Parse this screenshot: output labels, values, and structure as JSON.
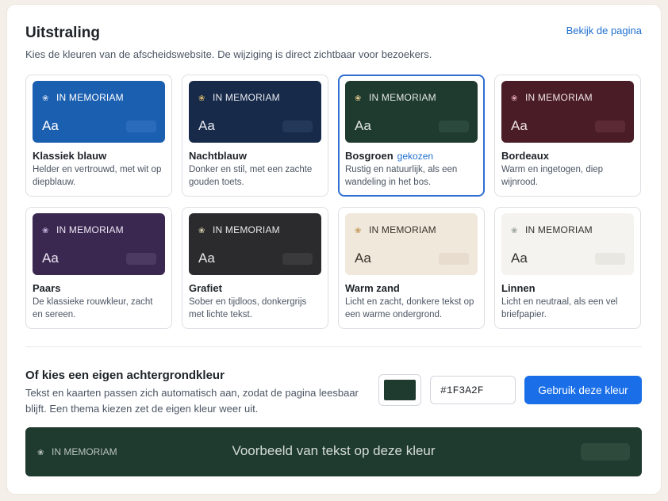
{
  "header": {
    "title": "Uitstraling",
    "view_link": "Bekijk de pagina",
    "subtitle": "Kies de kleuren van de afscheidswebsite. De wijziging is direct zichtbaar voor bezoekers."
  },
  "themes": [
    {
      "name": "Klassiek blauw",
      "desc": "Helder en vertrouwd, met wit op diepblauw.",
      "memo": "IN MEMORIAM",
      "aa": "Aa",
      "bg": "#1b5fb0",
      "text": "#ffffff",
      "pill": "#2a6cbb",
      "flower": "#c7d6ee",
      "selected": false
    },
    {
      "name": "Nachtblauw",
      "desc": "Donker en stil, met een zachte gouden toets.",
      "memo": "IN MEMORIAM",
      "aa": "Aa",
      "bg": "#172a4a",
      "text": "#e8eaef",
      "pill": "#24395a",
      "flower": "#d4b56a",
      "selected": false
    },
    {
      "name": "Bosgroen",
      "chosen": "gekozen",
      "desc": "Rustig en natuurlijk, als een wandeling in het bos.",
      "memo": "IN MEMORIAM",
      "aa": "Aa",
      "bg": "#1f3a2f",
      "text": "#e3e9e5",
      "pill": "#2b4a3d",
      "flower": "#d8c58a",
      "selected": true
    },
    {
      "name": "Bordeaux",
      "desc": "Warm en ingetogen, diep wijnrood.",
      "memo": "IN MEMORIAM",
      "aa": "Aa",
      "bg": "#4a1c26",
      "text": "#efe3e5",
      "pill": "#5c2a34",
      "flower": "#e0a4b4",
      "selected": false
    },
    {
      "name": "Paars",
      "desc": "De klassieke rouwkleur, zacht en sereen.",
      "memo": "IN MEMORIAM",
      "aa": "Aa",
      "bg": "#3b2850",
      "text": "#ece6f3",
      "pill": "#4c3a62",
      "flower": "#c6b2e0",
      "selected": false
    },
    {
      "name": "Grafiet",
      "desc": "Sober en tijdloos, donkergrijs met lichte tekst.",
      "memo": "IN MEMORIAM",
      "aa": "Aa",
      "bg": "#2b2b2d",
      "text": "#e8e8ea",
      "pill": "#3a3a3d",
      "flower": "#d0c7a8",
      "selected": false
    },
    {
      "name": "Warm zand",
      "desc": "Licht en zacht, donkere tekst op een warme ondergrond.",
      "memo": "IN MEMORIAM",
      "aa": "Aa",
      "bg": "#f1e8dc",
      "text": "#3a3328",
      "pill": "#e7dccd",
      "flower": "#c29a5c",
      "selected": false
    },
    {
      "name": "Linnen",
      "desc": "Licht en neutraal, als een vel briefpapier.",
      "memo": "IN MEMORIAM",
      "aa": "Aa",
      "bg": "#f4f3ef",
      "text": "#33332f",
      "pill": "#e9e7e1",
      "flower": "#9aa39a",
      "selected": false
    }
  ],
  "custom": {
    "title": "Of kies een eigen achtergrondkleur",
    "desc": "Tekst en kaarten passen zich automatisch aan, zodat de pagina leesbaar blijft. Een thema kiezen zet de eigen kleur weer uit.",
    "hex_value": "#1F3A2F",
    "button": "Gebruik deze kleur"
  },
  "preview": {
    "memo": "IN MEMORIAM",
    "sample": "Voorbeeld van tekst op deze kleur",
    "bg": "#1f3a2f"
  },
  "icons": {
    "flower": "flower-icon"
  }
}
